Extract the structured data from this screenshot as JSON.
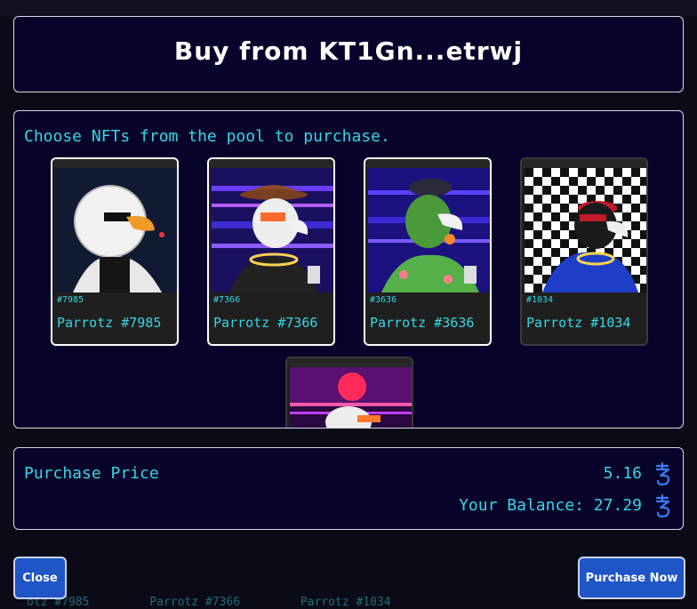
{
  "modal": {
    "title": "Buy from KT1Gn...etrwj"
  },
  "pool": {
    "instructions": "Choose NFTs from the pool to purchase.",
    "cards": [
      {
        "id": "#7985",
        "name": "Parrotz #7985",
        "selected": true
      },
      {
        "id": "#7366",
        "name": "Parrotz #7366",
        "selected": true
      },
      {
        "id": "#3636",
        "name": "Parrotz #3636",
        "selected": true
      },
      {
        "id": "#1034",
        "name": "Parrotz #1034",
        "selected": false
      },
      {
        "id": "",
        "name": "",
        "selected": false
      }
    ]
  },
  "purchase": {
    "price_label": "Purchase Price",
    "price_value": "5.16",
    "balance_text": "Your Balance: 27.29",
    "currency_icon": "tezos-icon"
  },
  "buttons": {
    "close_label": "Close",
    "purchase_label": "Purchase Now"
  },
  "background": {
    "fragments": [
      "otz #7985",
      "Parrotz #7366",
      "Parrotz #1034"
    ]
  },
  "colors": {
    "accent_cyan": "#35d7e4",
    "panel_bg": "#08032a",
    "button_blue": "#1f55c6"
  }
}
